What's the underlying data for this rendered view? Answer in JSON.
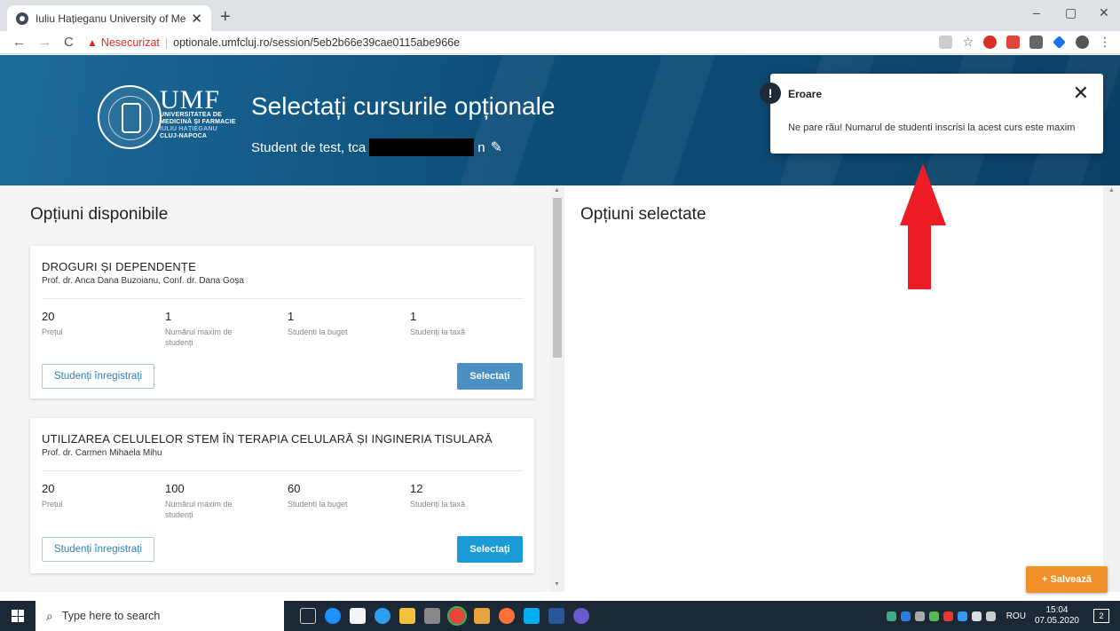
{
  "browser": {
    "tab_title": "Iuliu Hațieganu University of Me",
    "new_tab": "+",
    "minimize": "–",
    "restore": "▢",
    "close": "✕",
    "insecure_label": "Nesecurizat",
    "url": "optionale.umfcluj.ro/session/5eb2b66e39cae0115abe966e"
  },
  "header": {
    "logo_big": "UMF",
    "logo_line1": "UNIVERSITATEA DE",
    "logo_line2": "MEDICINĂ ȘI FARMACIE",
    "logo_line3": "IULIU HAȚIEGANU",
    "logo_line4": "CLUJ-NAPOCA",
    "title": "Selectați cursurile opționale",
    "student_prefix": "Student de test, tca",
    "student_suffix": "n"
  },
  "toast": {
    "title": "Eroare",
    "message": "Ne pare rău! Numarul de studenti inscrisi la acest curs este maxim"
  },
  "left": {
    "title": "Opțiuni disponibile",
    "cards": [
      {
        "name": "DROGURI ȘI DEPENDENȚE",
        "prof": "Prof. dr. Anca Dana Buzoianu, Conf. dr. Dana Goșa",
        "stats": [
          {
            "value": "20",
            "label": "Prețul"
          },
          {
            "value": "1",
            "label": "Numărul maxim de studenți"
          },
          {
            "value": "1",
            "label": "Studenti la buget"
          },
          {
            "value": "1",
            "label": "Studenți la taxă"
          }
        ],
        "registered": "Studenți înregistrați",
        "select": "Selectați"
      },
      {
        "name": "UTILIZAREA CELULELOR STEM ÎN TERAPIA CELULARĂ ȘI INGINERIA TISULARĂ",
        "prof": "Prof. dr. Carmen Mihaela Mihu",
        "stats": [
          {
            "value": "20",
            "label": "Prețul"
          },
          {
            "value": "100",
            "label": "Numărul maxim de studenți"
          },
          {
            "value": "60",
            "label": "Studenti la buget"
          },
          {
            "value": "12",
            "label": "Studenți la taxă"
          }
        ],
        "registered": "Studenți înregistrați",
        "select": "Selectați"
      }
    ]
  },
  "right": {
    "title": "Opțiuni selectate",
    "save": "+ Salvează"
  },
  "taskbar": {
    "search_placeholder": "Type here to search",
    "lang": "ROU",
    "time": "15:04",
    "date": "07.05.2020",
    "notif_count": "2"
  },
  "colors": {
    "select_disabled": "#4a90c2",
    "select_active": "#1a9ad6",
    "save": "#f0912a",
    "arrow": "#ee1c24"
  }
}
